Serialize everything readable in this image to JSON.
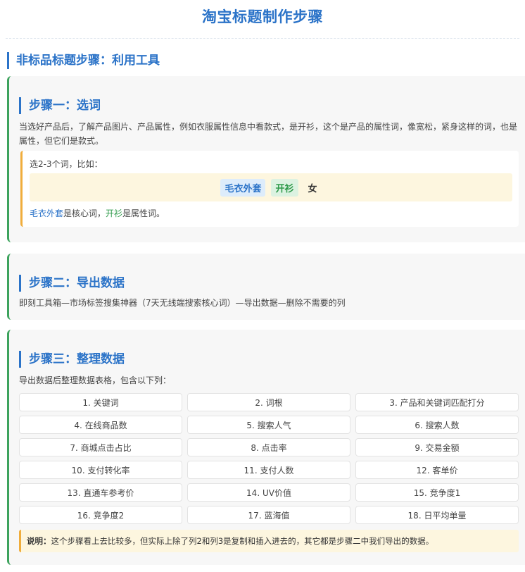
{
  "page": {
    "title": "淘宝标题制作步骤"
  },
  "section": {
    "heading": "非标品标题步骤：利用工具"
  },
  "step1": {
    "title": "步骤一：选词",
    "desc": "当选好产品后，了解产品图片、产品属性，例如衣服属性信息中看款式，是开衫，这个是产品的属性词，像宽松，紧身这样的词，也是属性，但它们是款式。",
    "example": {
      "intro": "选2-3个词，比如：",
      "words": [
        "毛衣外套",
        "开衫",
        "女"
      ],
      "note_core": "毛衣外套",
      "note_mid": "是核心词，",
      "note_attr": "开衫",
      "note_end": "是属性词。"
    }
  },
  "step2": {
    "title": "步骤二：导出数据",
    "desc": "即刻工具箱—市场标签搜集神器（7天无线端搜索核心词）—导出数据—删除不需要的列"
  },
  "step3": {
    "title": "步骤三：整理数据",
    "desc": "导出数据后整理数据表格，包含以下列：",
    "columns": [
      "1. 关键词",
      "2. 词根",
      "3. 产品和关键词匹配打分",
      "4. 在线商品数",
      "5. 搜索人气",
      "6. 搜索人数",
      "7. 商城点击占比",
      "8. 点击率",
      "9. 交易金额",
      "10. 支付转化率",
      "11. 支付人数",
      "12. 客单价",
      "13. 直通车参考价",
      "14. UV价值",
      "15. 竞争度1",
      "16. 竞争度2",
      "17. 蓝海值",
      "18. 日平均单量"
    ],
    "note_label": "说明：",
    "note_text": "这个步骤看上去比较多，但实际上除了列2和列3是复制和插入进去的，其它都是步骤二中我们导出的数据。"
  },
  "colors": {
    "accent_blue": "#2b73c8",
    "accent_green": "#3da35d",
    "accent_orange": "#f0ad3c",
    "highlight_bg": "#fdf6df"
  }
}
